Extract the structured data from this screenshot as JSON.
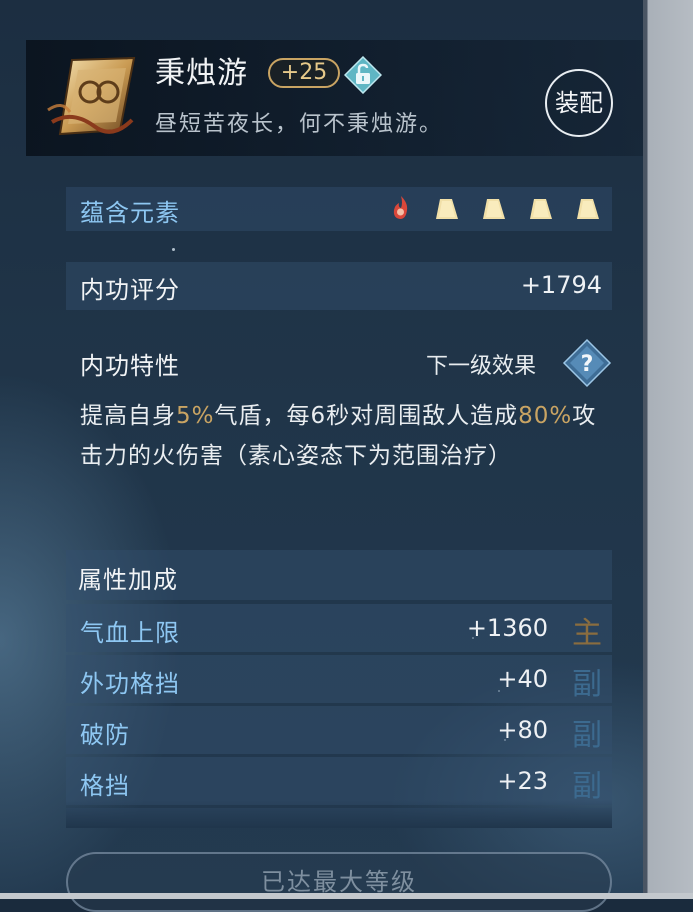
{
  "item": {
    "name": "秉烛游",
    "level": "+25",
    "description": "昼短苦夜长，何不秉烛游。",
    "icon": "golden-scroll-icon",
    "lock_icon": "unlock-diamond-icon"
  },
  "equip_button": {
    "label": "装配"
  },
  "elements": {
    "label": "蕴含元素",
    "icons": [
      "fire-element-icon",
      "rock-element-icon",
      "rock-element-icon",
      "rock-element-icon",
      "rock-element-icon"
    ]
  },
  "score": {
    "label": "内功评分",
    "value": "+1794"
  },
  "trait": {
    "title": "内功特性",
    "next_effect_label": "下一级效果",
    "text_part1": "提高自身",
    "pct1": "5%",
    "text_part2": "气盾，每6秒对周围敌人造成",
    "pct2": "80%",
    "text_part3": "攻击力的火伤害（素心姿态下为范围治疗）"
  },
  "attributes": {
    "header": "属性加成",
    "rows": [
      {
        "name": "气血上限",
        "value": "+1360",
        "tag": "主"
      },
      {
        "name": "外功格挡",
        "value": "+40",
        "tag": "副"
      },
      {
        "name": "破防",
        "value": "+80",
        "tag": "副"
      },
      {
        "name": "格挡",
        "value": "+23",
        "tag": "副"
      }
    ]
  },
  "bottom_button": {
    "label": "已达最大等级"
  },
  "colors": {
    "accent_gold": "#c9a463",
    "label_blue": "#8ec7f2",
    "panel_bg": "#203549"
  }
}
